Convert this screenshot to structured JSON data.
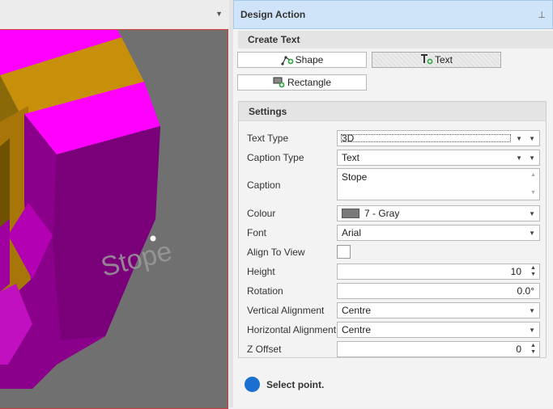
{
  "panel": {
    "title": "Design Action"
  },
  "create_text": {
    "section_title": "Create Text",
    "buttons": [
      {
        "label": "Shape",
        "icon": "shape-node-icon",
        "active": false
      },
      {
        "label": "Text",
        "icon": "text-add-icon",
        "active": true
      },
      {
        "label": "Rectangle",
        "icon": "rectangle-add-icon",
        "active": false
      }
    ]
  },
  "settings": {
    "section_title": "Settings",
    "text_type": {
      "label": "Text Type",
      "value": "3D"
    },
    "caption_type": {
      "label": "Caption Type",
      "value": "Text"
    },
    "caption": {
      "label": "Caption",
      "value": "Stope"
    },
    "colour": {
      "label": "Colour",
      "value": "7 - Gray",
      "swatch": "#7a7a7a"
    },
    "font": {
      "label": "Font",
      "value": "Arial"
    },
    "align_to_view": {
      "label": "Align To View",
      "checked": false
    },
    "height": {
      "label": "Height",
      "value": "10"
    },
    "rotation": {
      "label": "Rotation",
      "value": "0.0°"
    },
    "vertical_alignment": {
      "label": "Vertical Alignment",
      "value": "Centre"
    },
    "horizontal_alignment": {
      "label": "Horizontal Alignment",
      "value": "Centre"
    },
    "z_offset": {
      "label": "Z Offset",
      "value": "0"
    }
  },
  "status": {
    "text": "Select point.",
    "color": "#1a6fd0"
  },
  "viewport": {
    "label": "Stope",
    "colors": {
      "magenta": "#ff00ff",
      "purple": "#8a008a",
      "orange": "#c8900a",
      "background": "#707070",
      "border": "#d23c3c"
    }
  }
}
